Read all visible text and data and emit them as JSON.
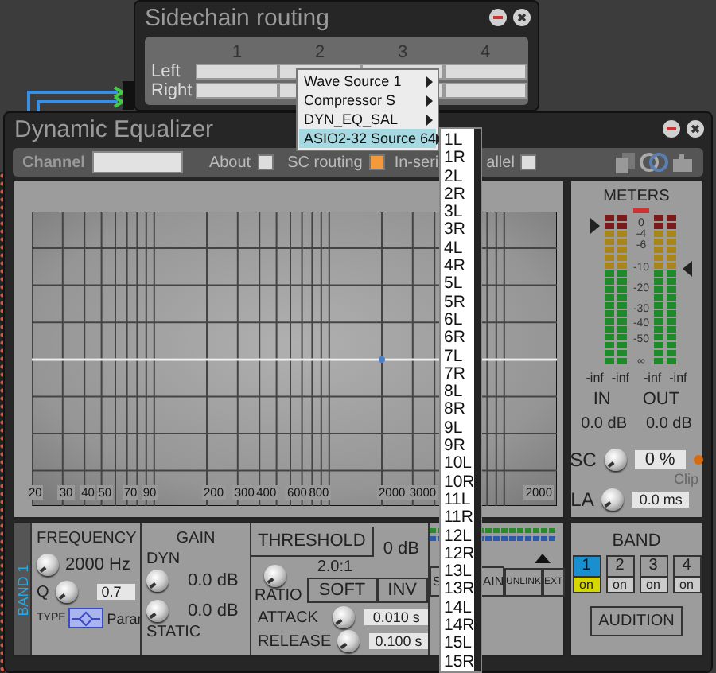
{
  "routing_window": {
    "title": "Sidechain routing",
    "columns": [
      "1",
      "2",
      "3",
      "4"
    ],
    "rows": [
      "Left",
      "Right"
    ]
  },
  "menu": {
    "items": [
      {
        "label": "Wave Source 1",
        "selected": false
      },
      {
        "label": "Compressor S",
        "selected": false
      },
      {
        "label": "DYN_EQ_SAL",
        "selected": false
      },
      {
        "label": "ASIO2-32 Source 64",
        "selected": true
      }
    ]
  },
  "submenu": {
    "items": [
      "1L",
      "1R",
      "2L",
      "2R",
      "3L",
      "3R",
      "4L",
      "4R",
      "5L",
      "5R",
      "6L",
      "6R",
      "7L",
      "7R",
      "8L",
      "8R",
      "9L",
      "9R",
      "10L",
      "10R",
      "11L",
      "11R",
      "12L",
      "12R",
      "13L",
      "13R",
      "14L",
      "14R",
      "15L",
      "15R"
    ]
  },
  "eq_window": {
    "title": "Dynamic Equalizer",
    "toolbar": {
      "channel_label": "Channel",
      "options": [
        {
          "label": "About",
          "checked": false
        },
        {
          "label": "SC routing",
          "checked": true
        }
      ],
      "series_label": "In-seri",
      "parallel": {
        "label": "allel",
        "checked": false
      }
    },
    "graph": {
      "freq_labels": [
        "20",
        "30",
        "40",
        "50",
        "70",
        "90",
        "200",
        "300",
        "400",
        "600",
        "800",
        "2000",
        "3000",
        "2000"
      ]
    },
    "meters": {
      "title": "METERS",
      "scale": [
        "0",
        "-4",
        "-6",
        "-10",
        "-20",
        "-30",
        "-40",
        "-50",
        "∞"
      ],
      "peaks": [
        "-inf",
        "-inf",
        "-inf",
        "-inf"
      ],
      "in_label": "IN",
      "out_label": "OUT",
      "in_value": "0.0 dB",
      "out_value": "0.0 dB",
      "sc_label": "SC",
      "sc_value": "0 %",
      "clip_label": "Clip",
      "la_label": "LA",
      "la_value": "0.0 ms"
    },
    "band": {
      "title": "BAND 1",
      "frequency": {
        "title": "FREQUENCY",
        "value": "2000 Hz",
        "q_label": "Q",
        "q": "0.7",
        "type_label": "TYPE",
        "type": "Parar"
      },
      "gain": {
        "title": "GAIN",
        "dyn_label": "DYN",
        "dyn": "0.0 dB",
        "static": "0.0 dB",
        "static_label": "STATIC"
      },
      "threshold": {
        "title": "THRESHOLD",
        "value": "0 dB",
        "ratio": "2.0:1",
        "ratio_label": "RATIO",
        "buttons": [
          "SOFT",
          "INV"
        ],
        "attack_label": "ATTACK",
        "attack": "0.010 s",
        "release_label": "RELEASE",
        "release": "0.100 s"
      },
      "sidechain_parts": [
        "S",
        "AIN"
      ],
      "side_buttons": [
        "UNLINK",
        "EXT"
      ]
    },
    "band_select": {
      "title": "BAND",
      "bands": [
        {
          "number": "1",
          "on": "on",
          "selected": true
        },
        {
          "number": "2",
          "on": "on",
          "selected": false
        },
        {
          "number": "3",
          "on": "on",
          "selected": false
        },
        {
          "number": "4",
          "on": "on",
          "selected": false
        }
      ],
      "audition": "AUDITION"
    }
  }
}
